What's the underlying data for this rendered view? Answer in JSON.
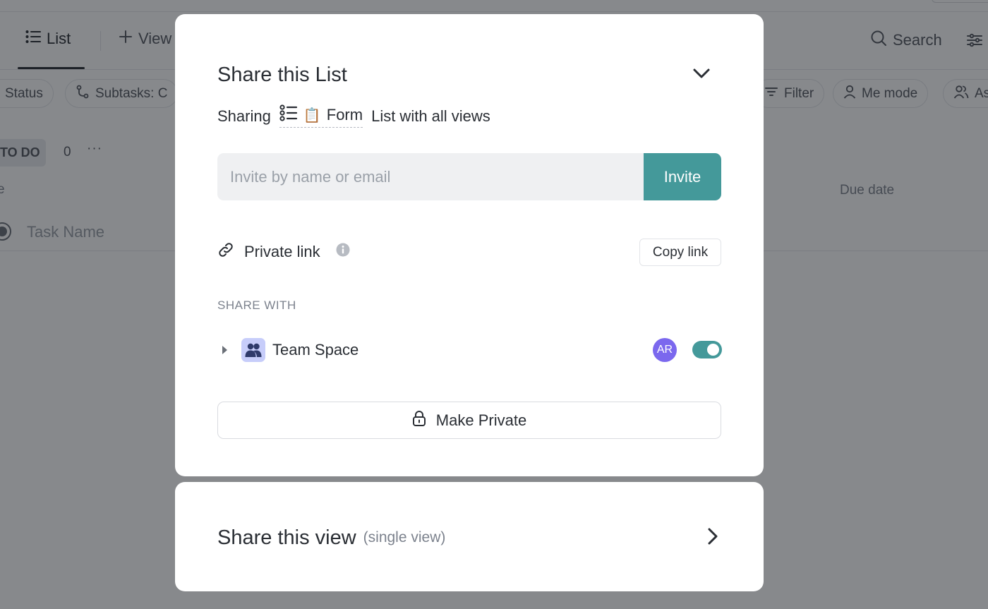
{
  "background": {
    "views_bar": {
      "tabs": [
        {
          "label": "List",
          "icon": "list-icon",
          "active": true
        },
        {
          "label": "View",
          "icon": "plus-icon",
          "active": false
        }
      ],
      "search_label": "Search",
      "settings_icon": "sliders-icon"
    },
    "chips": [
      {
        "label": "Status",
        "icon": "group-icon"
      },
      {
        "label": "Subtasks: C",
        "icon": "subtasks-icon"
      },
      {
        "label": "Filter",
        "icon": "filter-icon"
      },
      {
        "label": "Me mode",
        "icon": "user-icon"
      },
      {
        "label": "As",
        "icon": "users-icon"
      }
    ],
    "group": {
      "label": "TO DO",
      "count": "0",
      "more": "···"
    },
    "columns": {
      "name_partial": "e",
      "due_date": "Due date"
    },
    "task_placeholder": "Task Name"
  },
  "share_list": {
    "title": "Share this List",
    "collapse_icon": "chevron-down-icon",
    "sharing_prefix": "Sharing",
    "sharing_target": "Form",
    "sharing_target_emoji": "📋",
    "sharing_suffix": "List with all views",
    "invite": {
      "placeholder": "Invite by name or email",
      "value": "",
      "button_label": "Invite"
    },
    "private_link": {
      "label": "Private link",
      "copy_label": "Copy link"
    },
    "share_with": {
      "heading": "SHARE WITH",
      "items": [
        {
          "name": "Team Space",
          "avatar_initials": "AR",
          "enabled": true
        }
      ]
    },
    "make_private_label": "Make Private"
  },
  "share_view": {
    "title": "Share this view",
    "subtitle": "(single view)"
  },
  "colors": {
    "accent": "#44999a",
    "avatar": "#7b68ee",
    "space_icon_bg": "#c7cdfa",
    "space_icon_fg": "#2f3a6b"
  }
}
